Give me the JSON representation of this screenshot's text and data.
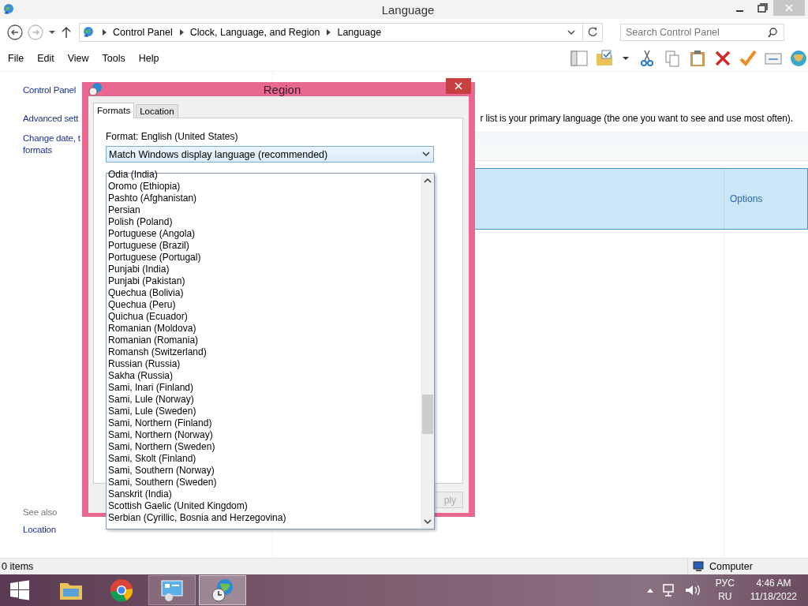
{
  "window": {
    "title": "Language"
  },
  "address_bar": {
    "path": [
      "Control Panel",
      "Clock, Language, and Region",
      "Language"
    ]
  },
  "search": {
    "placeholder": "Search Control Panel"
  },
  "menu": [
    "File",
    "Edit",
    "View",
    "Tools",
    "Help"
  ],
  "sidebar": {
    "items": [
      {
        "lines": [
          "Control Panel"
        ],
        "kind": "home"
      },
      {
        "lines": [
          "Advanced sett"
        ],
        "kind": "link"
      },
      {
        "lines": [
          "Change date, t",
          "formats"
        ],
        "kind": "link"
      }
    ],
    "see_also": {
      "heading": "See also",
      "links": [
        "Location"
      ]
    }
  },
  "description": "r list is your primary language (the one you want to see and use most often).",
  "language_list": {
    "rows": [
      {
        "selected": true,
        "action": "Options"
      }
    ]
  },
  "status_bar": {
    "items": "0 items",
    "location": "Computer"
  },
  "dialog": {
    "title": "Region",
    "tabs": [
      {
        "label": "Formats",
        "selected": true
      },
      {
        "label": "Location",
        "selected": false
      }
    ],
    "format_label": "Format: English (United States)",
    "format_select": {
      "value": "Match Windows display language (recommended)",
      "expanded": true,
      "options": [
        "Odia (India)",
        "Oromo (Ethiopia)",
        "Pashto (Afghanistan)",
        "Persian",
        "Polish (Poland)",
        "Portuguese (Angola)",
        "Portuguese (Brazil)",
        "Portuguese (Portugal)",
        "Punjabi (India)",
        "Punjabi (Pakistan)",
        "Quechua (Bolivia)",
        "Quechua (Peru)",
        "Quichua (Ecuador)",
        "Romanian (Moldova)",
        "Romanian (Romania)",
        "Romansh (Switzerland)",
        "Russian (Russia)",
        "Sakha (Russia)",
        "Sami, Inari (Finland)",
        "Sami, Lule (Norway)",
        "Sami, Lule (Sweden)",
        "Sami, Northern (Finland)",
        "Sami, Northern (Norway)",
        "Sami, Northern (Sweden)",
        "Sami, Skolt (Finland)",
        "Sami, Southern (Norway)",
        "Sami, Southern (Sweden)",
        "Sanskrit (India)",
        "Scottish Gaelic (United Kingdom)",
        "Serbian (Cyrillic, Bosnia and Herzegovina)"
      ]
    },
    "apply_button": {
      "label": "ply",
      "disabled": true
    }
  },
  "taskbar": {
    "apps": [
      {
        "kind": "explorer",
        "running": false,
        "selected": false
      },
      {
        "kind": "chrome",
        "running": false,
        "selected": false
      },
      {
        "kind": "control-panel",
        "running": true,
        "selected": false
      },
      {
        "kind": "region",
        "running": true,
        "selected": true
      }
    ],
    "tray": {
      "input_language": "РУС",
      "locale": "RU",
      "time": "4:46 AM",
      "date": "11/18/2022"
    }
  }
}
